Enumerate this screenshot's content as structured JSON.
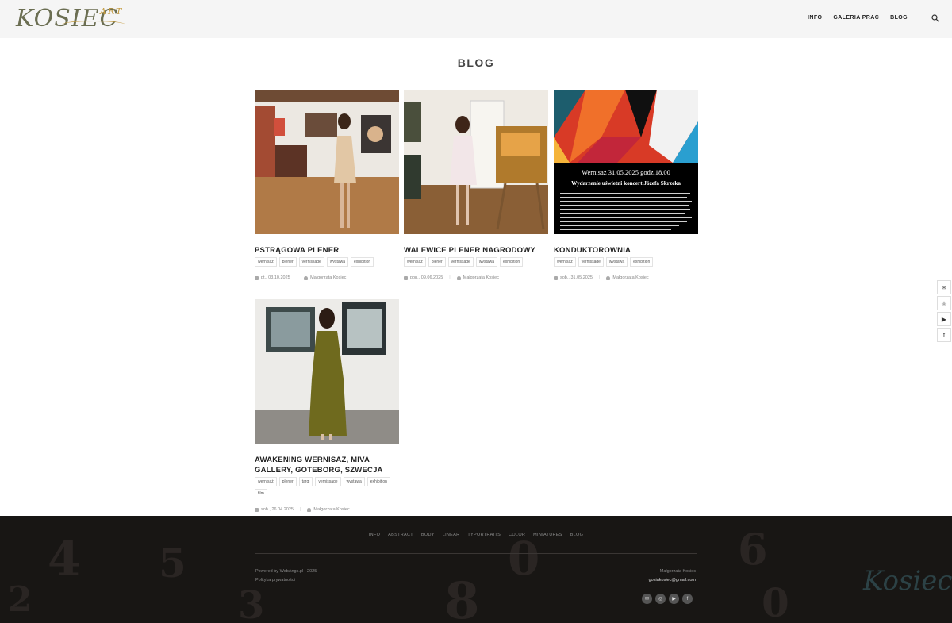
{
  "header": {
    "logo_text": "KOSIEC",
    "logo_suffix": "ART",
    "nav": [
      "INFO",
      "GALERIA PRAC",
      "BLOG"
    ]
  },
  "page_title": "BLOG",
  "posts": [
    {
      "title": "PSTRĄGOWA PLENER",
      "tags": [
        "wernisaż",
        "plener",
        "vernissage",
        "wystawa",
        "exhibition"
      ],
      "date": "pt., 03.10.2025",
      "author": "Małgorzata Kosiec"
    },
    {
      "title": "WALEWICE PLENER NAGRODOWY",
      "tags": [
        "wernisaż",
        "plener",
        "vernissage",
        "wystawa",
        "exhibition"
      ],
      "date": "pon., 09.06.2025",
      "author": "Małgorzata Kosiec"
    },
    {
      "title": "KONDUKTOROWNIA",
      "tags": [
        "wernisaż",
        "vernissage",
        "wystawa",
        "exhibition"
      ],
      "date": "sob., 31.05.2025",
      "author": "Małgorzata Kosiec",
      "poster_heading": "Wernisaż 31.05.2025 godz.18.00",
      "poster_subheading": "Wydarzenie uświetni koncert Józefa Skrzeka"
    },
    {
      "title": "AWAKENING WERNISAŻ, MIVA GALLERY, GOTEBORG, SZWECJA",
      "tags": [
        "wernisaż",
        "plener",
        "targi",
        "vernissage",
        "wystawa",
        "exhibition",
        "film"
      ],
      "date": "sob., 26.04.2025",
      "author": "Małgorzata Kosiec"
    }
  ],
  "side_social": [
    "email-icon",
    "instagram-icon",
    "youtube-icon",
    "facebook-icon"
  ],
  "footer": {
    "nav": [
      "INFO",
      "ABSTRACT",
      "BODY",
      "LINEAR",
      "TYPORTRAITS",
      "COLOR",
      "MINIATURES",
      "BLOG"
    ],
    "powered": "Powered by WebAngs.pl · 2025",
    "privacy": "Polityka prywatności",
    "contact_name": "Małgorzata Kosiec",
    "contact_email": "gosiakosiec@gmail.com",
    "logo": "Kosiec"
  }
}
